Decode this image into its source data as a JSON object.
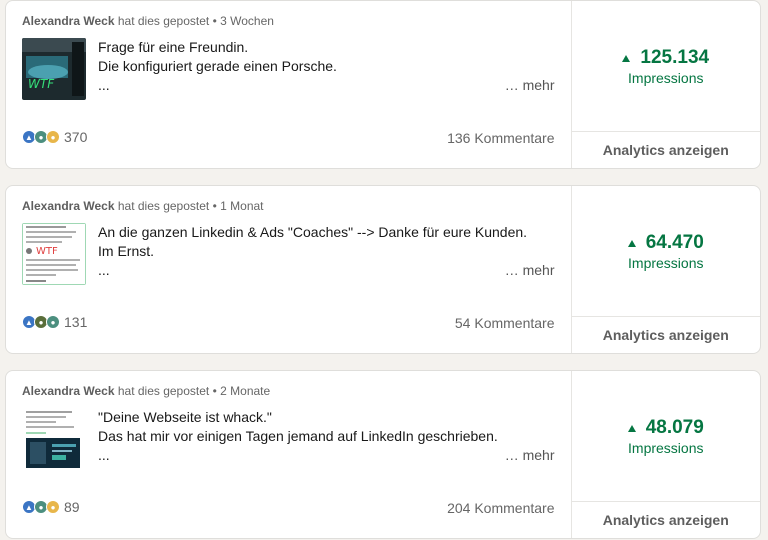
{
  "posts": [
    {
      "author": "Alexandra Weck",
      "action": "hat dies gepostet",
      "separator": "•",
      "time": "3 Wochen",
      "lines": [
        "Frage für eine Freundin.",
        "Die konfiguriert gerade einen Porsche.",
        "..."
      ],
      "more": "… mehr",
      "reaction_icons": [
        "like-icon",
        "praise-icon",
        "insight-icon"
      ],
      "reaction_count": "370",
      "comments": "136 Kommentare",
      "impressions_value": "125.134",
      "impressions_label": "Impressions",
      "analytics": "Analytics anzeigen"
    },
    {
      "author": "Alexandra Weck",
      "action": "hat dies gepostet",
      "separator": "•",
      "time": "1 Monat",
      "lines": [
        "An die ganzen Linkedin & Ads \"Coaches\" --> Danke für eure Kunden.",
        "Im Ernst.",
        "..."
      ],
      "more": "… mehr",
      "reaction_icons": [
        "like-icon",
        "support-icon",
        "praise-icon"
      ],
      "reaction_count": "131",
      "comments": "54 Kommentare",
      "impressions_value": "64.470",
      "impressions_label": "Impressions",
      "analytics": "Analytics anzeigen"
    },
    {
      "author": "Alexandra Weck",
      "action": "hat dies gepostet",
      "separator": "•",
      "time": "2 Monate",
      "lines": [
        "\"Deine Webseite ist whack.\"",
        "Das hat mir vor einigen Tagen jemand auf LinkedIn geschrieben.",
        "..."
      ],
      "more": "… mehr",
      "reaction_icons": [
        "like-icon",
        "praise-icon",
        "insight-icon"
      ],
      "reaction_count": "89",
      "comments": "204 Kommentare",
      "impressions_value": "48.079",
      "impressions_label": "Impressions",
      "analytics": "Analytics anzeigen"
    }
  ],
  "colors": {
    "positive": "#057642",
    "like": "#3b75c4",
    "praise": "#4c8f7f",
    "insight": "#e8b64a",
    "support": "#5a6e3a"
  }
}
